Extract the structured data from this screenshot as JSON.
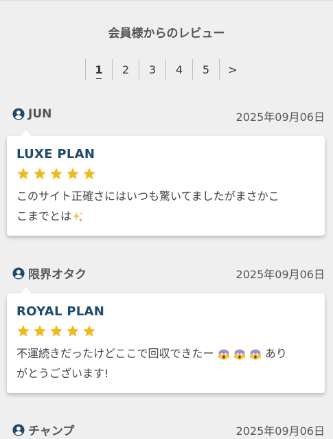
{
  "header": {
    "title": "会員様からのレビュー"
  },
  "pagination": {
    "pages": [
      "1",
      "2",
      "3",
      "4",
      "5"
    ],
    "current": "1",
    "next_label": ">"
  },
  "reviews": [
    {
      "user": "JUN",
      "date": "2025年09月06日",
      "plan": "LUXE PLAN",
      "rating": 5,
      "text_line1": "このサイト正確さにはいつも驚いてましたがまさかこ",
      "text_line2": "こまでとは",
      "emoji_icon": "sparkles-icon"
    },
    {
      "user": "限界オタク",
      "date": "2025年09月06日",
      "plan": "ROYAL PLAN",
      "rating": 5,
      "text_part1": "不運続きだったけどここで回収できたー",
      "text_part2": "あり",
      "text_line2": "がとうございます!",
      "emoji_icon": "screaming-face-icon"
    },
    {
      "user": "チャンプ",
      "date": "2025年09月06日"
    }
  ],
  "colors": {
    "plan": "#1c4a6e",
    "star": "#f2b91f",
    "user_icon": "#1c4a6e",
    "background": "#efefef"
  }
}
